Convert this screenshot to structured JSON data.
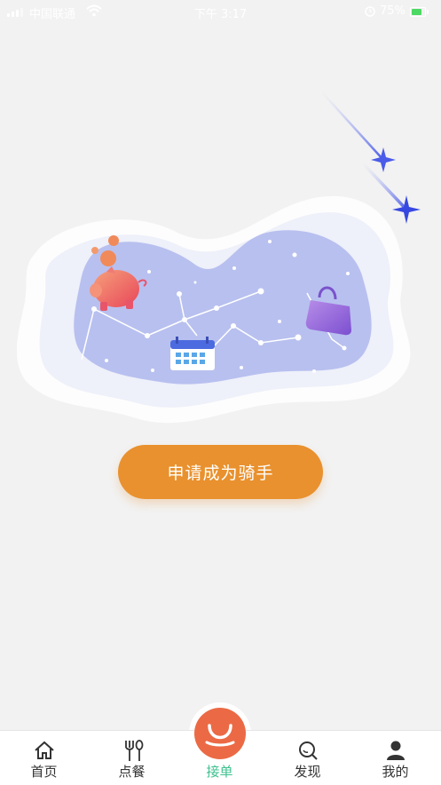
{
  "status_bar": {
    "carrier": "中国联通",
    "time": "下午 3:17",
    "battery": "75%"
  },
  "main": {
    "apply_button_label": "申请成为骑手"
  },
  "tab_bar": {
    "tabs": [
      {
        "label": "首页",
        "icon": "home-icon"
      },
      {
        "label": "点餐",
        "icon": "utensils-icon"
      },
      {
        "label": "接单",
        "icon": "order-icon",
        "active": true
      },
      {
        "label": "发现",
        "icon": "discover-icon"
      },
      {
        "label": "我的",
        "icon": "profile-icon"
      }
    ]
  },
  "colors": {
    "accent_orange": "#e9912e",
    "active_tab_green": "#3ec08f",
    "center_tab_red": "#eb6a45",
    "blob_blue": "#b8c0ef"
  }
}
